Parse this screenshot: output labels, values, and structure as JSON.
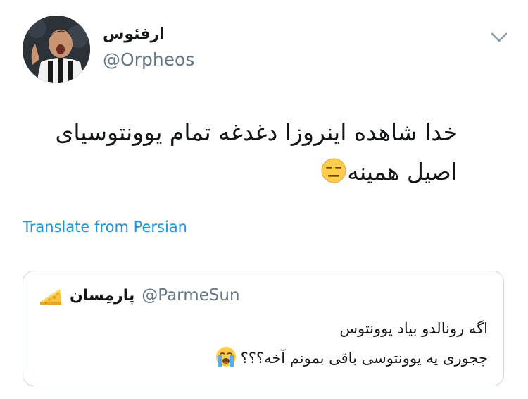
{
  "author": {
    "display_name": "ارفئوس",
    "handle": "@Orpheos"
  },
  "tweet": {
    "line1": "خدا شاهده اینروزا دغدغه تمام یوونتوسیای",
    "line2": "اصیل همینه"
  },
  "translate_label": "Translate from Persian",
  "quoted": {
    "display_name": "پارمِسان",
    "handle": "@ParmeSun",
    "line1": "اگه رونالدو بیاد یوونتوس",
    "line2": "چجوری یه یوونتوسی باقی بمونم آخه؟؟؟"
  },
  "icons": {
    "avatar": "profile-photo",
    "menu": "chevron-down-icon",
    "emoji1": "expressionless-face-icon",
    "emoji2": "cheese-wedge-icon",
    "emoji3": "loudly-crying-face-icon"
  }
}
